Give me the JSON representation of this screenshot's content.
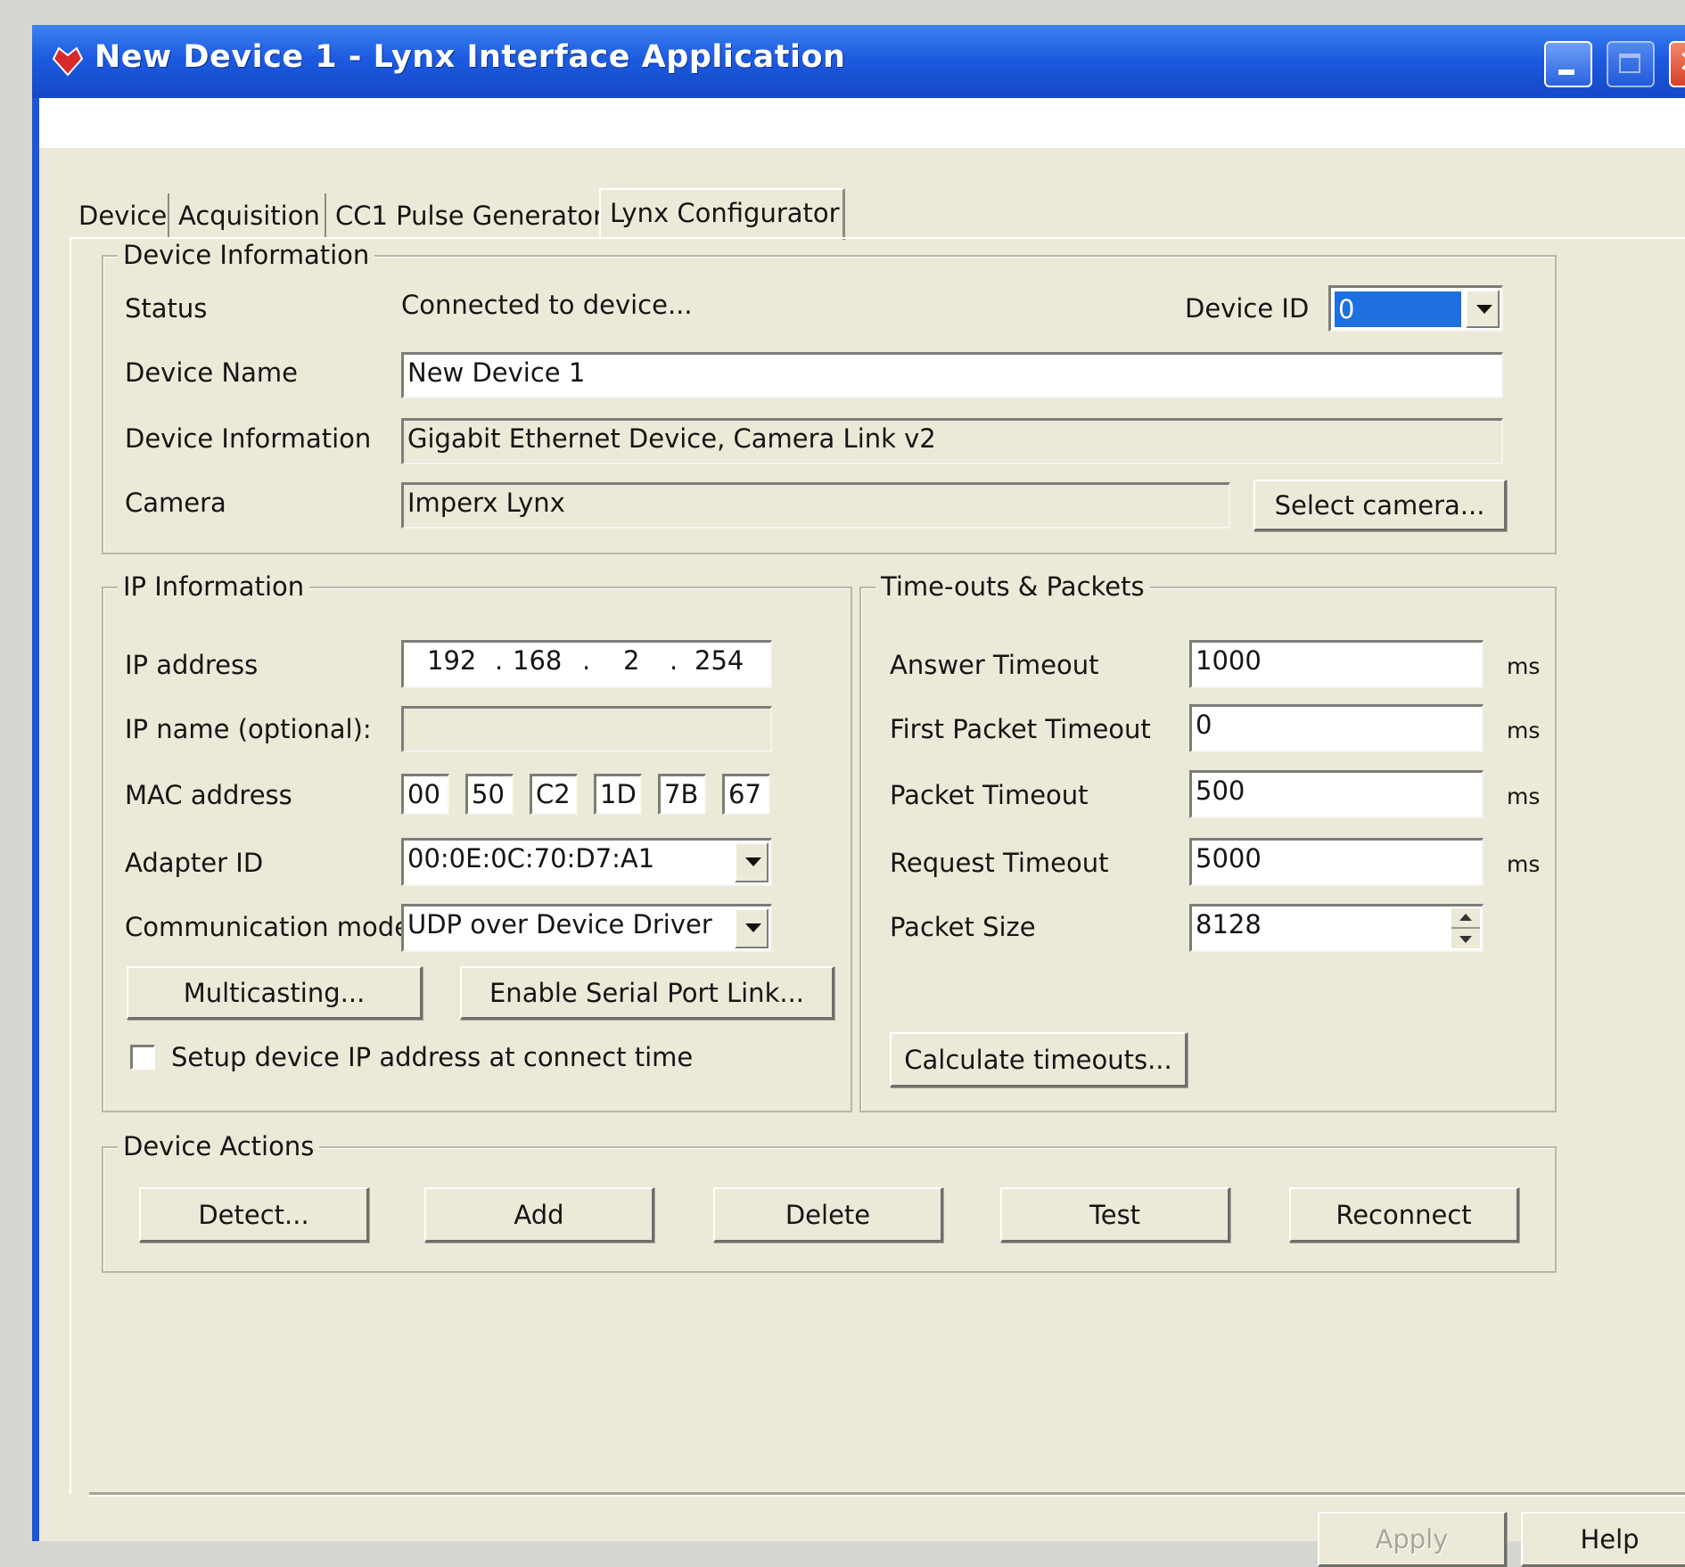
{
  "window": {
    "title": "New Device 1 - Lynx Interface Application"
  },
  "tabs": [
    {
      "label": "Device"
    },
    {
      "label": "Acquisition"
    },
    {
      "label": "CC1 Pulse Generator"
    },
    {
      "label": "Lynx Configurator",
      "active": true
    }
  ],
  "device_info": {
    "legend": "Device Information",
    "status_label": "Status",
    "status_value": "Connected to device...",
    "device_id_label": "Device ID",
    "device_id_value": "0",
    "name_label": "Device Name",
    "name_value": "New Device 1",
    "info_label": "Device Information",
    "info_value": "Gigabit Ethernet Device, Camera Link v2",
    "camera_label": "Camera",
    "camera_value": "Imperx Lynx",
    "select_camera": "Select camera..."
  },
  "ip_info": {
    "legend": "IP Information",
    "ip_label": "IP address",
    "ip_octets": [
      "192",
      "168",
      "2",
      "254"
    ],
    "ip_name_label": "IP name (optional):",
    "ip_name_value": "",
    "mac_label": "MAC address",
    "mac_parts": [
      "00",
      "50",
      "C2",
      "1D",
      "7B",
      "67"
    ],
    "adapter_label": "Adapter ID",
    "adapter_value": "00:0E:0C:70:D7:A1",
    "comm_label": "Communication mode:",
    "comm_value": "UDP over Device Driver",
    "multicasting": "Multicasting...",
    "serial_link": "Enable Serial Port Link...",
    "setup_ip_label": "Setup device IP address at connect time",
    "setup_ip_checked": false
  },
  "timeouts": {
    "legend": "Time-outs & Packets",
    "answer_label": "Answer Timeout",
    "answer_value": "1000",
    "first_packet_label": "First Packet Timeout",
    "first_packet_value": "0",
    "packet_label": "Packet Timeout",
    "packet_value": "500",
    "request_label": "Request Timeout",
    "request_value": "5000",
    "size_label": "Packet Size",
    "size_value": "8128",
    "unit": "ms",
    "calculate": "Calculate timeouts..."
  },
  "actions": {
    "legend": "Device Actions",
    "detect": "Detect...",
    "add": "Add",
    "delete": "Delete",
    "test": "Test",
    "reconnect": "Reconnect"
  },
  "footer": {
    "apply": "Apply",
    "help": "Help"
  },
  "colors": {
    "titlebar": "#1c5be0",
    "dialog": "#ece9d8",
    "selection": "#1e6fe0"
  }
}
